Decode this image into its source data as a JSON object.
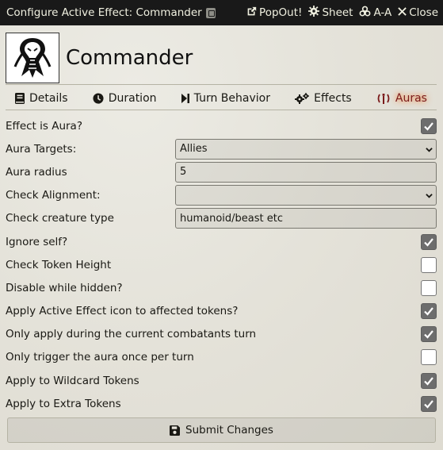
{
  "window": {
    "title": "Configure Active Effect: Commander",
    "header_buttons": [
      {
        "label": "PopOut!",
        "icon": "external-link-icon"
      },
      {
        "label": "Sheet",
        "icon": "gear-icon"
      },
      {
        "label": "A-A",
        "icon": "biohazard-icon"
      },
      {
        "label": "Close",
        "icon": "close-icon"
      }
    ]
  },
  "profile": {
    "name": "Commander",
    "image": "cobra-emblem"
  },
  "tabs": [
    {
      "label": "Details",
      "icon": "book-icon"
    },
    {
      "label": "Duration",
      "icon": "clock-icon"
    },
    {
      "label": "Turn Behavior",
      "icon": "step-forward-icon"
    },
    {
      "label": "Effects",
      "icon": "cogs-icon"
    },
    {
      "label": "Auras",
      "icon": "broadcast-icon",
      "active": true
    }
  ],
  "form": {
    "effect_is_aura": {
      "label": "Effect is Aura?",
      "checked": true
    },
    "aura_targets": {
      "label": "Aura Targets:",
      "value": "Allies"
    },
    "aura_radius": {
      "label": "Aura radius",
      "value": "5"
    },
    "check_alignment": {
      "label": "Check Alignment:",
      "value": ""
    },
    "check_creature_type": {
      "label": "Check creature type",
      "placeholder": "humanoid/beast etc"
    },
    "ignore_self": {
      "label": "Ignore self?",
      "checked": true
    },
    "check_token_height": {
      "label": "Check Token Height",
      "checked": false
    },
    "disable_while_hidden": {
      "label": "Disable while hidden?",
      "checked": false
    },
    "apply_icon": {
      "label": "Apply Active Effect icon to affected tokens?",
      "checked": true
    },
    "only_combatants_turn": {
      "label": "Only apply during the current combatants turn",
      "checked": true
    },
    "trigger_once": {
      "label": "Only trigger the aura once per turn",
      "checked": false
    },
    "wildcard_tokens": {
      "label": "Apply to Wildcard Tokens",
      "checked": true
    },
    "extra_tokens": {
      "label": "Apply to Extra Tokens",
      "checked": true
    }
  },
  "submit": {
    "label": "Submit Changes",
    "icon": "save-icon"
  },
  "colors": {
    "header_bg": "#191919",
    "active_tab": "#7a1a1a",
    "checkbox_on": "#6d6d6d"
  }
}
